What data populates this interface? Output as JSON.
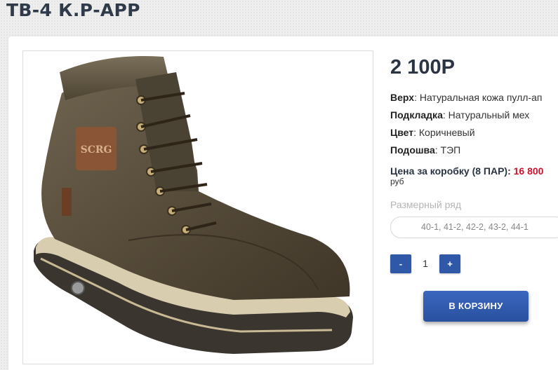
{
  "product": {
    "title": "ТВ-4 К.Р-АРР",
    "price": "2 100Р",
    "specs": [
      {
        "label": "Верх",
        "value": ": Натуральная кожа пулл-ап"
      },
      {
        "label": "Подкладка",
        "value": ": Натуральный мех"
      },
      {
        "label": "Цвет",
        "value": ": Коричневый"
      },
      {
        "label": "Подошва",
        "value": ": ТЭП"
      }
    ],
    "box_price_label": "Цена за коробку (8 ПАР): ",
    "box_price_value": "16 800",
    "currency": "руб",
    "image_alt": "brown leather boot",
    "image_badge_text": "SCRG"
  },
  "sizes": {
    "label": "Размерный ряд",
    "selected": "40-1, 41-2, 42-2, 43-2, 44-1"
  },
  "quantity": {
    "minus_label": "-",
    "value": "1",
    "plus_label": "+"
  },
  "cart": {
    "button_label": "В КОРЗИНУ"
  },
  "colors": {
    "accent": "#2f58a8",
    "price_red": "#d0112b",
    "title": "#2f3b4a"
  }
}
